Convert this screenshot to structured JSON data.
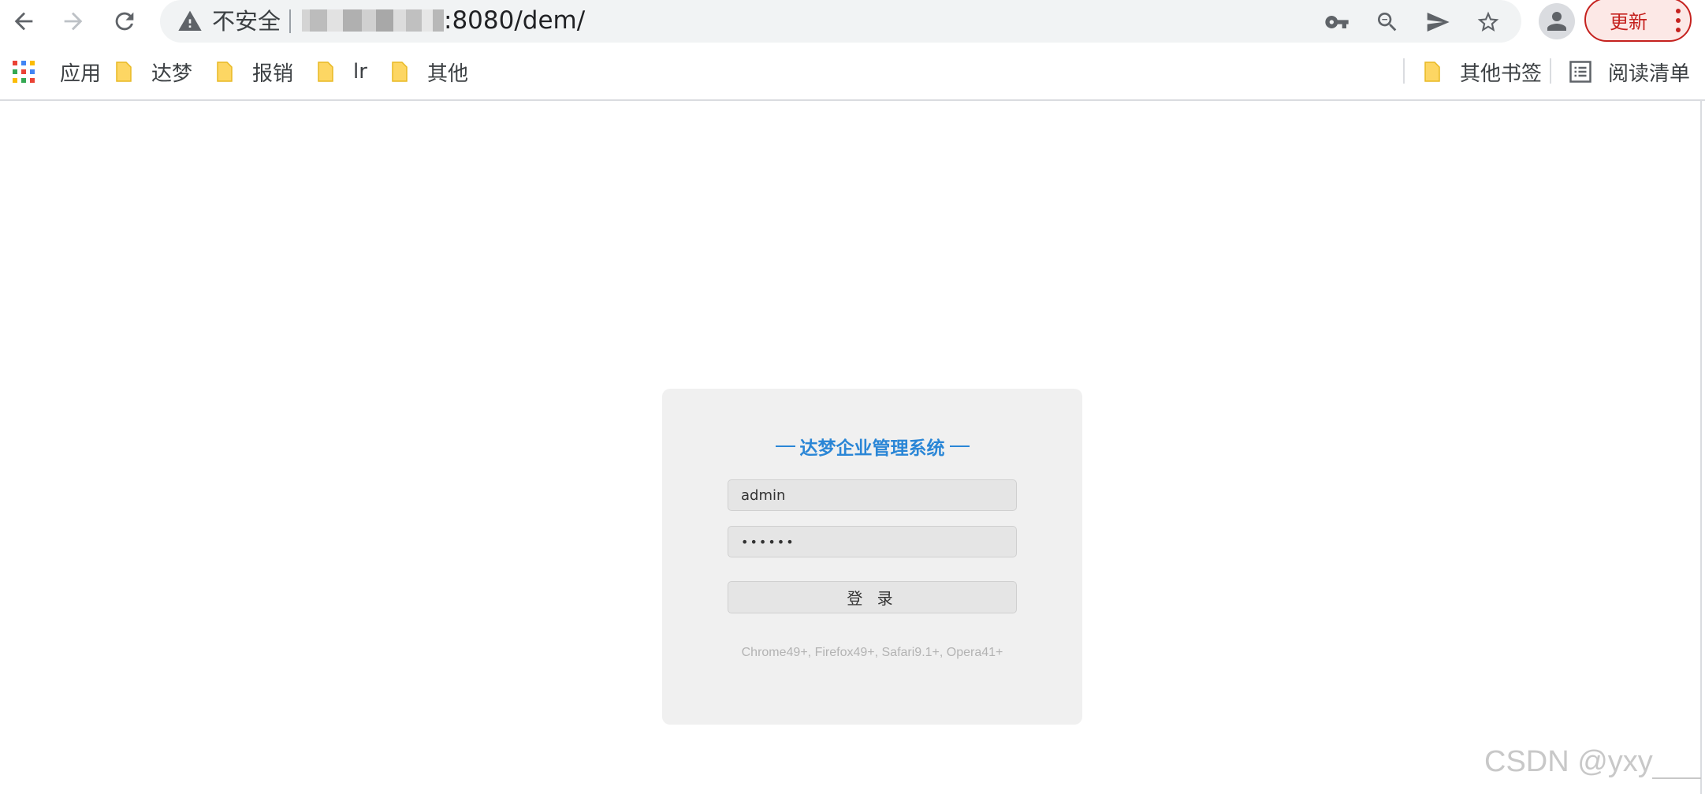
{
  "browser": {
    "security_label": "不安全",
    "url_visible": ":8080/dem/",
    "update_label": "更新",
    "icons": {
      "back": "back-arrow-icon",
      "forward": "forward-arrow-icon",
      "reload": "reload-icon",
      "warning": "warning-icon",
      "key": "key-icon",
      "zoom": "zoom-out-icon",
      "send": "send-icon",
      "star": "star-icon",
      "profile": "profile-icon",
      "menu": "kebab-menu-icon"
    }
  },
  "bookmarks": {
    "apps_label": "应用",
    "items": [
      {
        "label": "达梦"
      },
      {
        "label": "报销"
      },
      {
        "label": "lr"
      },
      {
        "label": "其他"
      }
    ],
    "other_label": "其他书签",
    "reading_list_label": "阅读清单"
  },
  "login": {
    "title": "达梦企业管理系统",
    "username_value": "admin",
    "password_value": "••••••",
    "submit_label": "登 录",
    "compat_text": "Chrome49+, Firefox49+, Safari9.1+, Opera41+"
  },
  "watermark": "CSDN @yxy",
  "colors": {
    "accent": "#2a86d6",
    "update_red": "#c5221f",
    "panel_bg": "#f0f0f0",
    "folder": "#fdd663"
  }
}
